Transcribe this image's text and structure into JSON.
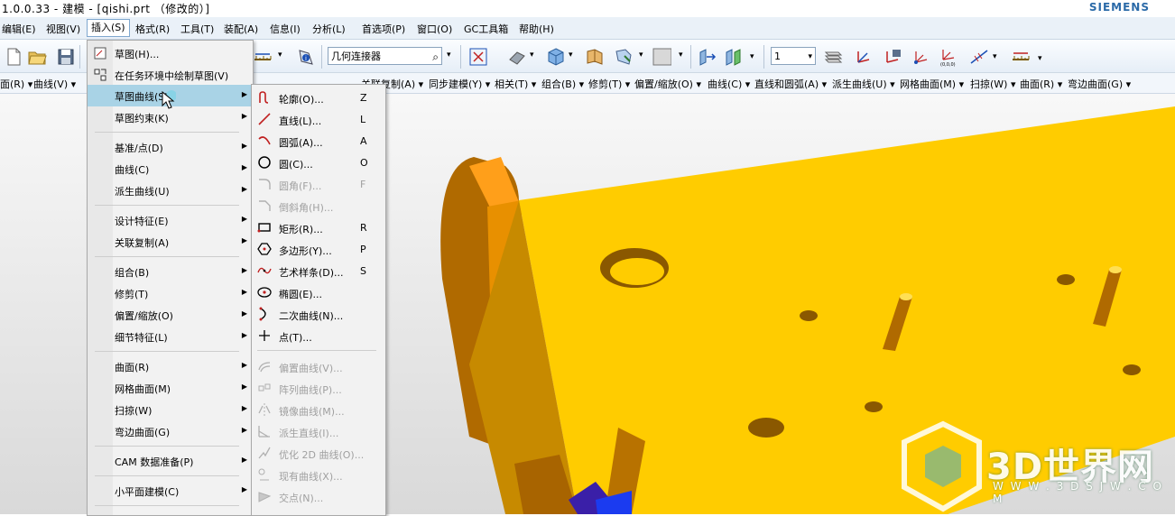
{
  "window": {
    "title": "1.0.0.33 - 建模 - [qishi.prt （修改的）]",
    "brand": "SIEMENS"
  },
  "menubar": {
    "items": [
      "编辑(E)",
      "视图(V)",
      "插入(S)",
      "格式(R)",
      "工具(T)",
      "装配(A)",
      "信息(I)",
      "分析(L)",
      "首选项(P)",
      "窗口(O)",
      "GC工具箱",
      "帮助(H)"
    ]
  },
  "toolbar": {
    "search_value": "几何连接器",
    "layer_value": "1"
  },
  "cmdbar": {
    "items": [
      "面(R) ▾",
      "曲线(V) ▾",
      "关联复制(A) ▾",
      "同步建模(Y) ▾",
      "相关(T) ▾",
      "组合(B) ▾",
      "修剪(T) ▾",
      "偏置/缩放(O) ▾",
      "曲线(C) ▾",
      "直线和圆弧(A) ▾",
      "派生曲线(U) ▾",
      "网格曲面(M) ▾",
      "扫掠(W) ▾",
      "曲面(R) ▾",
      "弯边曲面(G) ▾"
    ]
  },
  "insert_menu": {
    "items": [
      {
        "label": "草图(H)...",
        "arrow": false,
        "icon": "sketch-icon"
      },
      {
        "label": "在任务环境中绘制草图(V)",
        "arrow": false,
        "icon": "sketch-task-icon"
      },
      {
        "label": "草图曲线(S)",
        "arrow": true,
        "icon": ""
      },
      {
        "label": "草图约束(K)",
        "arrow": true,
        "icon": ""
      },
      {
        "label": "基准/点(D)",
        "arrow": true,
        "icon": ""
      },
      {
        "label": "曲线(C)",
        "arrow": true,
        "icon": ""
      },
      {
        "label": "派生曲线(U)",
        "arrow": true,
        "icon": ""
      },
      {
        "label": "设计特征(E)",
        "arrow": true,
        "icon": ""
      },
      {
        "label": "关联复制(A)",
        "arrow": true,
        "icon": ""
      },
      {
        "label": "组合(B)",
        "arrow": true,
        "icon": ""
      },
      {
        "label": "修剪(T)",
        "arrow": true,
        "icon": ""
      },
      {
        "label": "偏置/缩放(O)",
        "arrow": true,
        "icon": ""
      },
      {
        "label": "细节特征(L)",
        "arrow": true,
        "icon": ""
      },
      {
        "label": "曲面(R)",
        "arrow": true,
        "icon": ""
      },
      {
        "label": "网格曲面(M)",
        "arrow": true,
        "icon": ""
      },
      {
        "label": "扫掠(W)",
        "arrow": true,
        "icon": ""
      },
      {
        "label": "弯边曲面(G)",
        "arrow": true,
        "icon": ""
      },
      {
        "label": "CAM 数据准备(P)",
        "arrow": true,
        "icon": ""
      },
      {
        "label": "小平面建模(C)",
        "arrow": true,
        "icon": ""
      }
    ]
  },
  "sketch_curve_menu": {
    "items": [
      {
        "label": "轮廓(O)...",
        "key": "Z",
        "enabled": true,
        "icon": "profile-icon"
      },
      {
        "label": "直线(L)...",
        "key": "L",
        "enabled": true,
        "icon": "line-icon"
      },
      {
        "label": "圆弧(A)...",
        "key": "A",
        "enabled": true,
        "icon": "arc-icon"
      },
      {
        "label": "圆(C)...",
        "key": "O",
        "enabled": true,
        "icon": "circle-icon"
      },
      {
        "label": "圆角(F)...",
        "key": "F",
        "enabled": false,
        "icon": "fillet-icon"
      },
      {
        "label": "倒斜角(H)...",
        "key": "",
        "enabled": false,
        "icon": "chamfer-icon"
      },
      {
        "label": "矩形(R)...",
        "key": "R",
        "enabled": true,
        "icon": "rectangle-icon"
      },
      {
        "label": "多边形(Y)...",
        "key": "P",
        "enabled": true,
        "icon": "polygon-icon"
      },
      {
        "label": "艺术样条(D)...",
        "key": "S",
        "enabled": true,
        "icon": "spline-icon"
      },
      {
        "label": "椭圆(E)...",
        "key": "",
        "enabled": true,
        "icon": "ellipse-icon"
      },
      {
        "label": "二次曲线(N)...",
        "key": "",
        "enabled": true,
        "icon": "conic-icon"
      },
      {
        "label": "点(T)...",
        "key": "",
        "enabled": true,
        "icon": "point-icon"
      },
      {
        "label": "偏置曲线(V)...",
        "key": "",
        "enabled": false,
        "icon": "offset-curve-icon"
      },
      {
        "label": "阵列曲线(P)...",
        "key": "",
        "enabled": false,
        "icon": "pattern-curve-icon"
      },
      {
        "label": "镜像曲线(M)...",
        "key": "",
        "enabled": false,
        "icon": "mirror-curve-icon"
      },
      {
        "label": "派生直线(I)...",
        "key": "",
        "enabled": false,
        "icon": "derived-line-icon"
      },
      {
        "label": "优化 2D 曲线(O)...",
        "key": "",
        "enabled": false,
        "icon": "optimize-2d-icon"
      },
      {
        "label": "现有曲线(X)...",
        "key": "",
        "enabled": false,
        "icon": "existing-curve-icon"
      },
      {
        "label": "交点(N)...",
        "key": "",
        "enabled": false,
        "icon": "intersection-icon"
      }
    ]
  },
  "watermark": {
    "logo_text": "3D世界网",
    "url_text": "W W W . 3 D S J W . C O M"
  },
  "colors": {
    "part_face": "#ffcc00",
    "part_side": "#c78a00",
    "menu_highlight": "#a9d3e6",
    "brand": "#2b6aa8"
  }
}
